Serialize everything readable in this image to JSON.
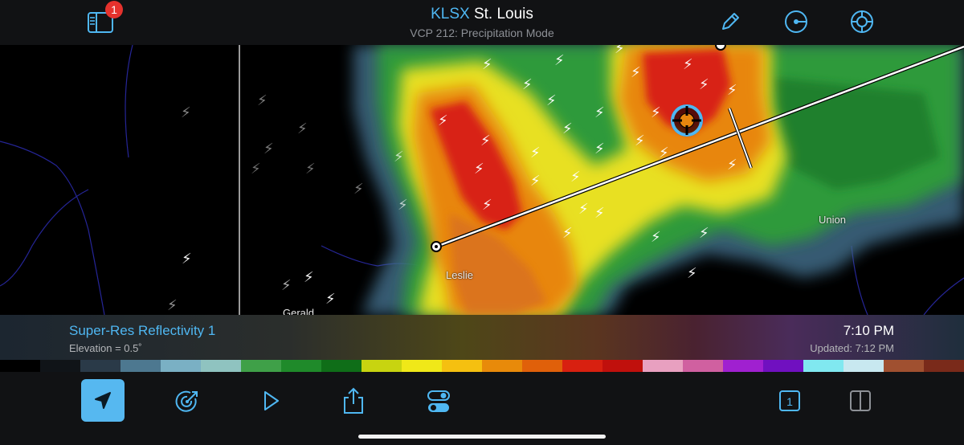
{
  "header": {
    "station_id": "KLSX",
    "station_name": "St. Louis",
    "vcp_text": "VCP 212: Precipitation Mode",
    "notification_count": "1",
    "icons": [
      "sidebar-icon",
      "pencil-icon",
      "center-radar-icon",
      "crosshair-target-icon"
    ]
  },
  "map": {
    "places": [
      "Union",
      "Leslie",
      "Gerald"
    ]
  },
  "product_bar": {
    "product_name": "Super-Res Reflectivity 1",
    "elevation": "Elevation = 0.5˚",
    "time": "7:10 PM",
    "updated": "Updated: 7:12 PM"
  },
  "color_scale": [
    "#000000",
    "#101418",
    "#2a3a48",
    "#4d7890",
    "#7ab0c4",
    "#8fc3c0",
    "#3fa048",
    "#1f8a2a",
    "#0f6e18",
    "#c8d410",
    "#f0e818",
    "#f5c010",
    "#e88a0a",
    "#e0600a",
    "#d82010",
    "#c0100c",
    "#e8a0c0",
    "#d060a0",
    "#a020d0",
    "#7010c0",
    "#80e8f0",
    "#c8e8f0",
    "#a05030",
    "#7a2a1a"
  ],
  "toolbar": {
    "icons": [
      "location-arrow-icon",
      "radar-sweep-icon",
      "play-icon",
      "share-icon",
      "settings-toggle-icon",
      "single-pane-icon",
      "split-pane-icon"
    ],
    "single_pane_label": "1"
  },
  "colors": {
    "accent": "#4fb7f2",
    "bar_background": "#111214",
    "badge": "#e5322d"
  }
}
